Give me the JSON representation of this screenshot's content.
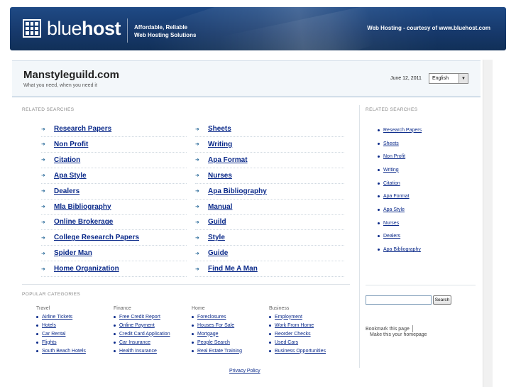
{
  "banner": {
    "logo_light": "blue",
    "logo_bold": "host",
    "tagline_line1": "Affordable, Reliable",
    "tagline_line2": "Web Hosting Solutions",
    "courtesy": "Web Hosting - courtesy of www.bluehost.com"
  },
  "header": {
    "title": "Manstyleguild.com",
    "subtitle": "What you need, when you need it",
    "date": "June 12, 2011",
    "language": "English"
  },
  "related": {
    "label": "RELATED SEARCHES",
    "left": [
      "Research Papers",
      "Non Profit",
      "Citation",
      "Apa Style",
      "Dealers",
      "Mla Bibliography",
      "Online Brokerage",
      "College Research Papers",
      "Spider Man",
      "Home Organization"
    ],
    "right": [
      "Sheets",
      "Writing",
      "Apa Format",
      "Nurses",
      "Apa Bibliography",
      "Manual",
      "Guild",
      "Style",
      "Guide",
      "Find Me A Man"
    ]
  },
  "side_related": {
    "label": "RELATED SEARCHES",
    "items": [
      "Research Papers",
      "Sheets",
      "Non Profit",
      "Writing",
      "Citation",
      "Apa Format",
      "Apa Style",
      "Nurses",
      "Dealers",
      "Apa Bibliography"
    ]
  },
  "popular": {
    "label": "POPULAR CATEGORIES",
    "categories": [
      {
        "title": "Travel",
        "items": [
          "Airline Tickets",
          "Hotels",
          "Car Rental",
          "Flights",
          "South Beach Hotels"
        ]
      },
      {
        "title": "Finance",
        "items": [
          "Free Credit Report",
          "Online Payment",
          "Credit Card Application",
          "Car Insurance",
          "Health Insurance"
        ]
      },
      {
        "title": "Home",
        "items": [
          "Foreclosures",
          "Houses For Sale",
          "Mortgage",
          "People Search",
          "Real Estate Training"
        ]
      },
      {
        "title": "Business",
        "items": [
          "Employment",
          "Work From Home",
          "Reorder Checks",
          "Used Cars",
          "Business Opportunities"
        ]
      }
    ]
  },
  "search": {
    "button": "Search",
    "value": ""
  },
  "bookmark": {
    "bookmark_label": "Bookmark this page",
    "homepage_label": "Make this your homepage"
  },
  "footer": {
    "privacy": "Privacy Policy"
  },
  "colors": {
    "banner": "#1a3f75",
    "link": "#0b2a8a",
    "header_bg": "#f3f7fa"
  }
}
